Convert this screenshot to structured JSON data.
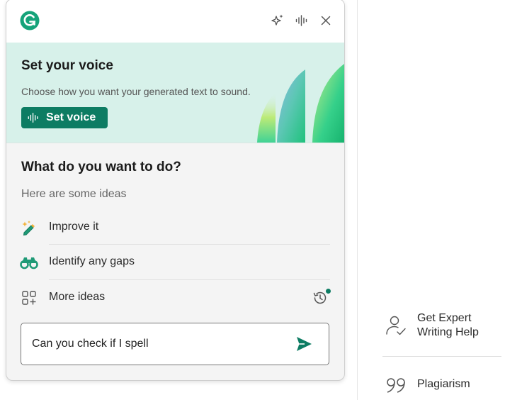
{
  "banner": {
    "title": "Set your voice",
    "subtitle": "Choose how you want your generated text to sound.",
    "button_label": "Set voice"
  },
  "header": {
    "icons": [
      "grammarly-logo-icon",
      "sparkle-icon",
      "voice-wave-icon",
      "close-icon"
    ]
  },
  "main": {
    "title": "What do you want to do?",
    "ideas_label": "Here are some ideas",
    "ideas": [
      {
        "label": "Improve it",
        "icon": "magic-pencil-icon"
      },
      {
        "label": "Identify any gaps",
        "icon": "binoculars-icon"
      },
      {
        "label": "More ideas",
        "icon": "grid-plus-icon"
      }
    ]
  },
  "prompt": {
    "value": "Can you check if I spell",
    "placeholder": ""
  },
  "right_panel": {
    "expert_label_line1": "Get Expert",
    "expert_label_line2": "Writing Help",
    "plagiarism_label": "Plagiarism"
  },
  "colors": {
    "accent": "#0d7c63",
    "banner_bg": "#d7f1ea",
    "panel_bg": "#f4f4f4"
  }
}
